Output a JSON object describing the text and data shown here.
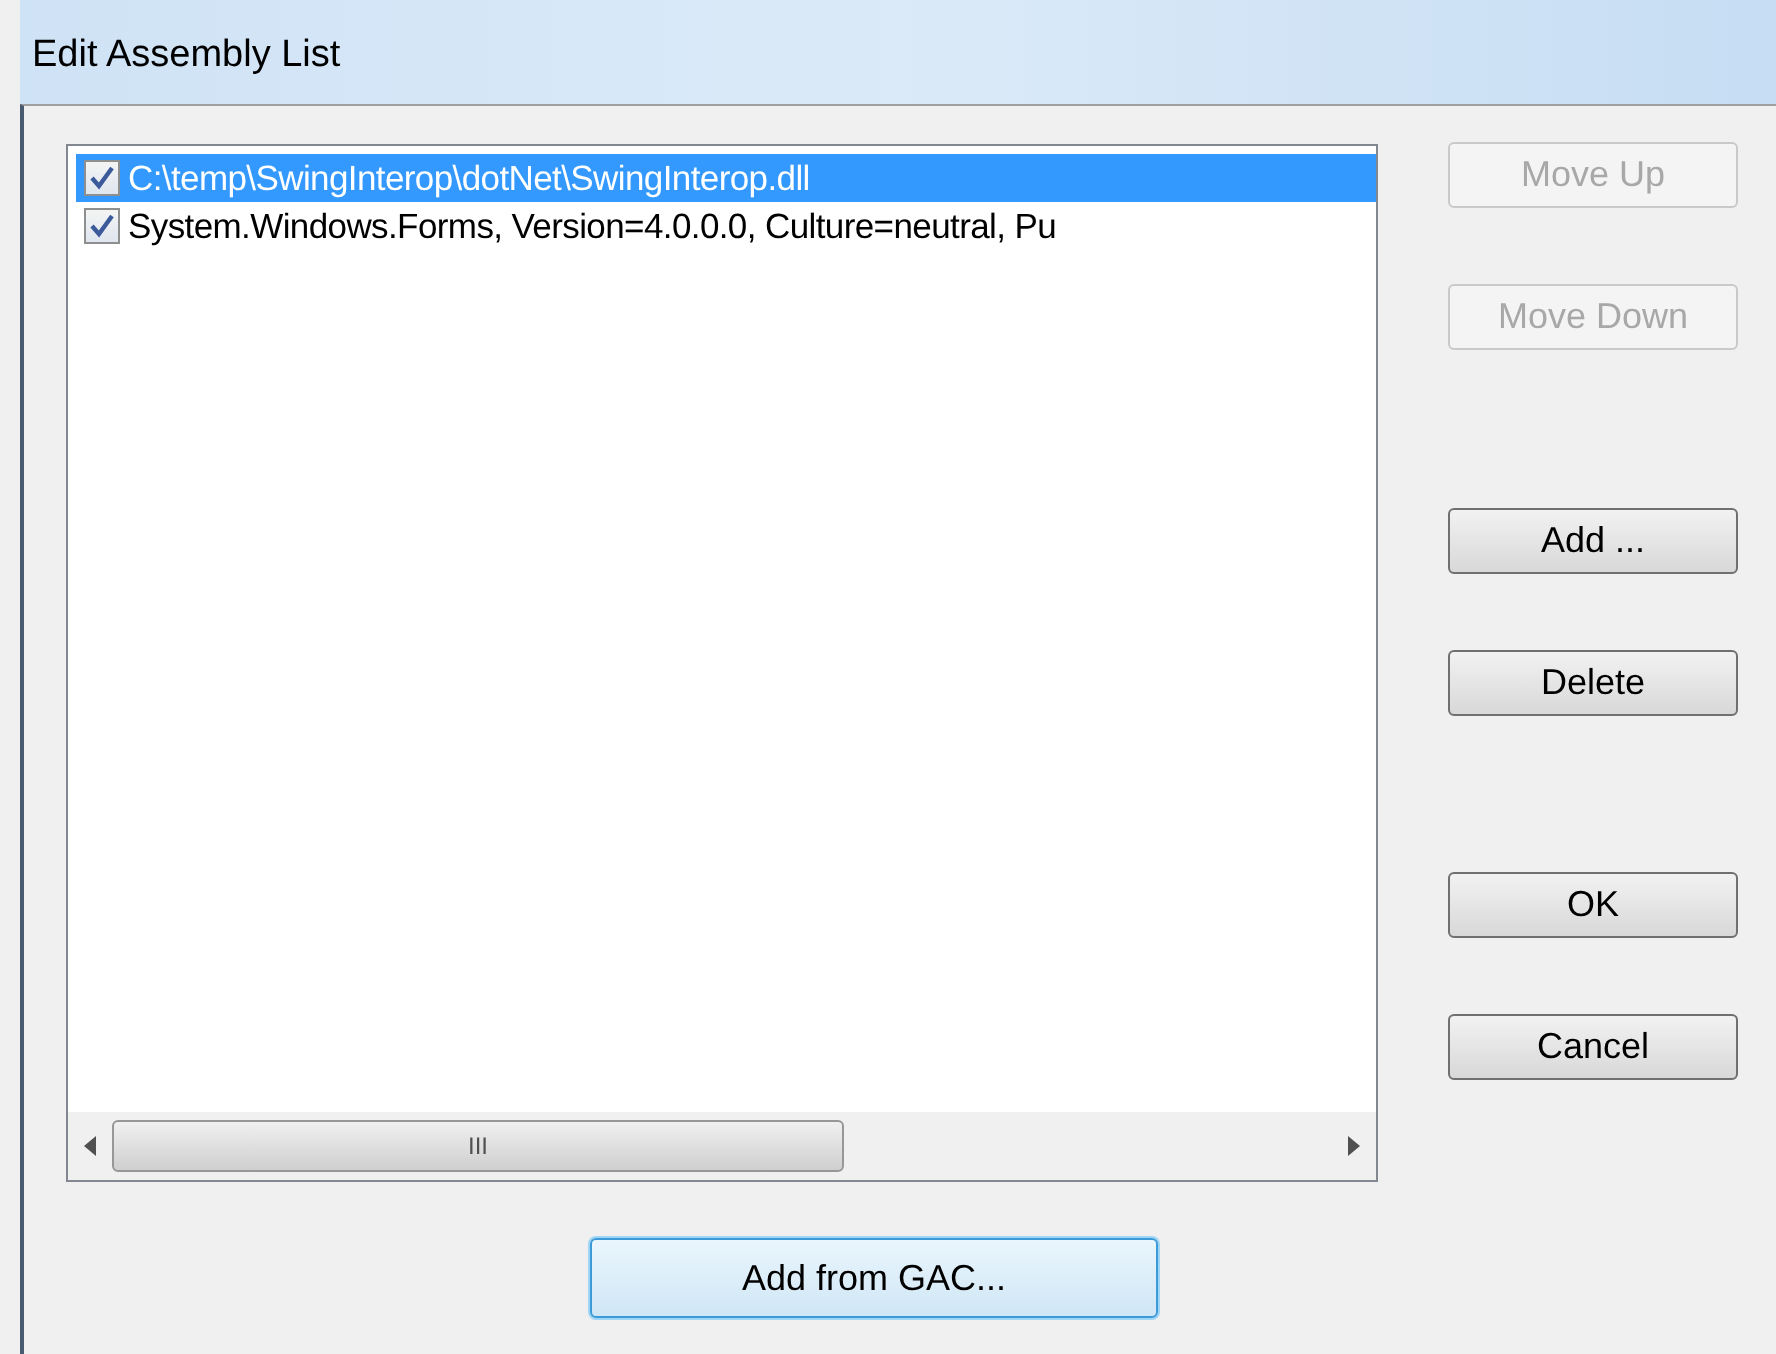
{
  "window": {
    "title": "Edit Assembly List"
  },
  "assemblies": [
    {
      "label": "C:\\temp\\SwingInterop\\dotNet\\SwingInterop.dll",
      "checked": true,
      "selected": true
    },
    {
      "label": "System.Windows.Forms, Version=4.0.0.0, Culture=neutral, Pu",
      "checked": true,
      "selected": false
    }
  ],
  "side_buttons": [
    {
      "label": "Move Up",
      "disabled": true
    },
    {
      "label": "Move Down",
      "disabled": true
    },
    {
      "label": "Add ...",
      "disabled": false
    },
    {
      "label": "Delete",
      "disabled": false
    },
    {
      "label": "OK",
      "disabled": false
    },
    {
      "label": "Cancel",
      "disabled": false
    }
  ],
  "scrollbar_thumb": {
    "label": "III"
  },
  "bottom_button": {
    "label": "Add from GAC...",
    "focused": true
  }
}
